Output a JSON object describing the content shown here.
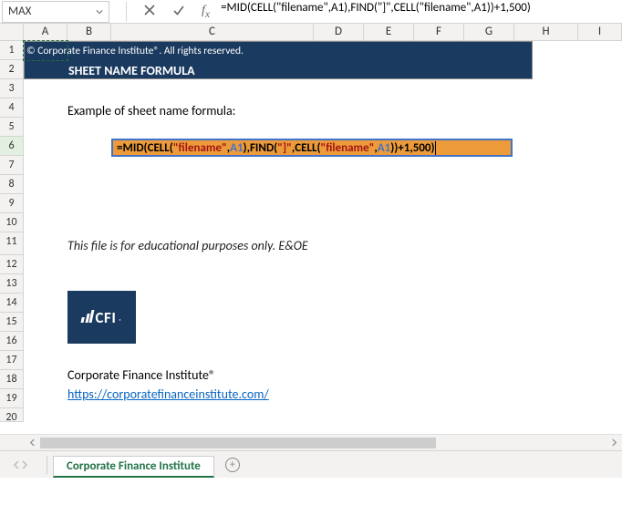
{
  "namebox": {
    "value": "MAX"
  },
  "formula_bar": {
    "text": "=MID(CELL(\"filename\",A1),FIND(\"]\",CELL(\"filename\",A1))+1,500)"
  },
  "columns": [
    "A",
    "B",
    "C",
    "D",
    "E",
    "F",
    "G",
    "H",
    "I"
  ],
  "rows": [
    "1",
    "2",
    "3",
    "4",
    "5",
    "6",
    "7",
    "8",
    "9",
    "10",
    "11",
    "12",
    "13",
    "14",
    "15",
    "16",
    "17",
    "18",
    "19",
    "20"
  ],
  "banner": {
    "copyright": "© Corporate Finance Institute®. All rights reserved.",
    "title": "SHEET NAME FORMULA"
  },
  "content": {
    "example_label": "Example of sheet name formula:",
    "disclaimer": "This file is for educational purposes only. E&OE",
    "org_name": "Corporate Finance Institute®",
    "url": "https://corporatefinanceinstitute.com/",
    "logo_text": "CFI"
  },
  "formula_cell": {
    "parts": [
      {
        "t": "=",
        "c": "eq"
      },
      {
        "t": "MID",
        "c": "fn"
      },
      {
        "t": "(",
        "c": "p"
      },
      {
        "t": "CELL",
        "c": "fn"
      },
      {
        "t": "(",
        "c": "p"
      },
      {
        "t": "\"filename\"",
        "c": "s"
      },
      {
        "t": ",",
        "c": "p"
      },
      {
        "t": "A1",
        "c": "ref"
      },
      {
        "t": ")",
        "c": "p"
      },
      {
        "t": ",",
        "c": "p"
      },
      {
        "t": "FIND",
        "c": "fn"
      },
      {
        "t": "(",
        "c": "p"
      },
      {
        "t": "\"]\"",
        "c": "s"
      },
      {
        "t": ",",
        "c": "p"
      },
      {
        "t": "CELL",
        "c": "fn"
      },
      {
        "t": "(",
        "c": "p"
      },
      {
        "t": "\"filename\"",
        "c": "s"
      },
      {
        "t": ",",
        "c": "p"
      },
      {
        "t": "A1",
        "c": "ref"
      },
      {
        "t": ")",
        "c": "p"
      },
      {
        "t": ")",
        "c": "p"
      },
      {
        "t": "+",
        "c": "p"
      },
      {
        "t": "1",
        "c": "n"
      },
      {
        "t": ",",
        "c": "p"
      },
      {
        "t": "500",
        "c": "n"
      },
      {
        "t": ")",
        "c": "p"
      }
    ]
  },
  "sheet_tab": {
    "name": "Corporate Finance Institute"
  }
}
